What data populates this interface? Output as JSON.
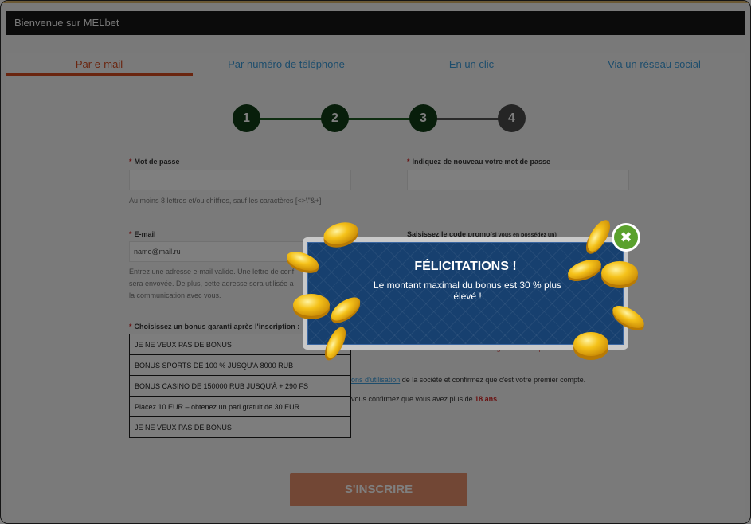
{
  "header": {
    "title": "Bienvenue sur MELbet"
  },
  "tabs": [
    {
      "label": "Par e-mail",
      "active": true
    },
    {
      "label": "Par numéro de téléphone",
      "active": false
    },
    {
      "label": "En un clic",
      "active": false
    },
    {
      "label": "Via un réseau social",
      "active": false
    }
  ],
  "steps": [
    {
      "number": "1",
      "state": "done"
    },
    {
      "number": "2",
      "state": "done"
    },
    {
      "number": "3",
      "state": "current"
    },
    {
      "number": "4",
      "state": "pending"
    }
  ],
  "form": {
    "password_label": "Mot de passe",
    "password_hint": "Au moins 8 lettres et/ou chiffres, sauf les caractères [<>\\\"&+]",
    "repeat_password_label": "Indiquez de nouveau votre mot de passe",
    "email_label": "E-mail",
    "email_value": "name@mail.ru",
    "email_hint_1": "Entrez une adresse e-mail valide. Une lettre de conf",
    "email_hint_2": "sera envoyée. De plus, cette adresse sera utilisée a",
    "email_hint_3": "la communication avec vous.",
    "promo_label": "Saisissez le code promo",
    "promo_label_small": "(si vous en possédez un)",
    "bonus_label": "Choisissez un bonus garanti après l'inscription :",
    "bonus_options": [
      "JE NE VEUX PAS DE BONUS",
      "BONUS SPORTS DE 100 % JUSQU'À 8000 RUB",
      "BONUS CASINO DE 150000 RUB JUSQU'À + 290 FS",
      "Placez 10 EUR – obtenez un pari gratuit de 30 EUR",
      "JE NE VEUX PAS DE BONUS"
    ],
    "required_note": "*Obligatoire à remplir",
    "terms_link": "ons d'utilisation",
    "terms_rest": " de la société et confirmez que c'est votre premier compte.",
    "age_text": "vous confirmez que vous avez plus de ",
    "age_value": "18 ans",
    "age_end": ".",
    "submit_label": "S'INSCRIRE"
  },
  "modal": {
    "title": "FÉLICITATIONS !",
    "message": "Le montant maximal du bonus est 30 % plus élevé !",
    "close_icon": "close-icon"
  },
  "colors": {
    "accent": "#d44a1e",
    "link": "#3a9ad9",
    "step_done": "#1f7a2a",
    "modal_bg": "#17406f",
    "close_green": "#5aa12d",
    "submit": "#e58f6a"
  }
}
